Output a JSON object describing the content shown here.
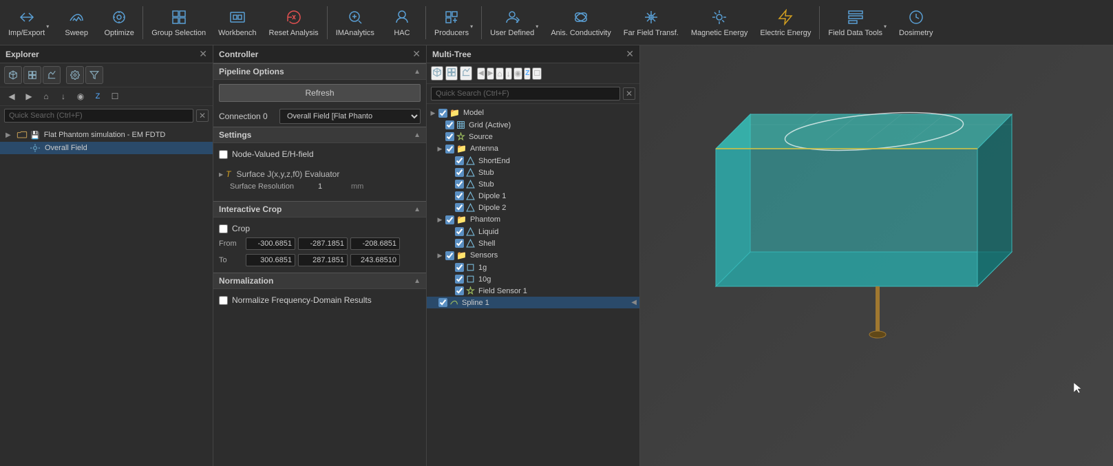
{
  "toolbar": {
    "items": [
      {
        "id": "imp-export",
        "label": "Imp/Export",
        "icon": "import-export-icon",
        "hasArrow": true
      },
      {
        "id": "sweep",
        "label": "Sweep",
        "icon": "sweep-icon",
        "hasArrow": false
      },
      {
        "id": "optimize",
        "label": "Optimize",
        "icon": "optimize-icon",
        "hasArrow": false
      },
      {
        "id": "group-selection",
        "label": "Group Selection",
        "icon": "group-selection-icon",
        "hasArrow": false
      },
      {
        "id": "workbench",
        "label": "Workbench",
        "icon": "workbench-icon",
        "hasArrow": false
      },
      {
        "id": "reset-analysis",
        "label": "Reset Analysis",
        "icon": "reset-analysis-icon",
        "hasArrow": false
      },
      {
        "id": "imanalytics",
        "label": "IMAnalytics",
        "icon": "imanalytics-icon",
        "hasArrow": false
      },
      {
        "id": "hac",
        "label": "HAC",
        "icon": "hac-icon",
        "hasArrow": false
      },
      {
        "id": "producers",
        "label": "Producers",
        "icon": "producers-icon",
        "hasArrow": true
      },
      {
        "id": "user-defined",
        "label": "User Defined",
        "icon": "user-defined-icon",
        "hasArrow": true
      },
      {
        "id": "anis-conductivity",
        "label": "Anis. Conductivity",
        "icon": "anis-icon",
        "hasArrow": false
      },
      {
        "id": "far-field-transf",
        "label": "Far Field Transf.",
        "icon": "far-field-icon",
        "hasArrow": false
      },
      {
        "id": "magnetic-energy",
        "label": "Magnetic Energy",
        "icon": "magnetic-energy-icon",
        "hasArrow": false
      },
      {
        "id": "electric-energy",
        "label": "Electric Energy",
        "icon": "electric-energy-icon",
        "hasArrow": false
      },
      {
        "id": "field-data-tools",
        "label": "Field Data Tools",
        "icon": "field-data-icon",
        "hasArrow": true
      },
      {
        "id": "dosimetry",
        "label": "Dosimetry",
        "icon": "dosimetry-icon",
        "hasArrow": false
      }
    ]
  },
  "explorer": {
    "title": "Explorer",
    "search_placeholder": "Quick Search (Ctrl+F)",
    "tree": [
      {
        "id": "sim-root",
        "label": "Flat Phantom simulation - EM FDTD",
        "indent": 0,
        "expanded": true,
        "hasExpand": true,
        "selected": false
      },
      {
        "id": "overall-field",
        "label": "Overall Field",
        "indent": 1,
        "expanded": false,
        "hasExpand": false,
        "selected": true
      }
    ]
  },
  "controller": {
    "title": "Controller",
    "pipeline_options_label": "Pipeline Options",
    "refresh_label": "Refresh",
    "connection_label": "Connection 0",
    "connection_value": "Overall Field [Flat Phanto",
    "settings_label": "Settings",
    "node_valued_label": "Node-Valued E/H-field",
    "node_valued_checked": false,
    "surface_j_label": "Surface J(x,y,z,f0) Evaluator",
    "surface_resolution_label": "Surface Resolution",
    "surface_resolution_value": "1",
    "surface_resolution_unit": "mm",
    "interactive_crop_label": "Interactive Crop",
    "crop_label": "Crop",
    "crop_checked": false,
    "from_label": "From",
    "from_x": "-300.6851",
    "from_y": "-287.1851",
    "from_z": "-208.6851",
    "to_label": "To",
    "to_x": "300.6851",
    "to_y": "287.1851",
    "to_z": "243.68510",
    "normalization_label": "Normalization",
    "normalize_label": "Normalize Frequency-Domain Results",
    "normalize_checked": false
  },
  "multitree": {
    "title": "Multi-Tree",
    "search_placeholder": "Quick Search (Ctrl+F)",
    "tree": [
      {
        "id": "model",
        "label": "Model",
        "indent": 0,
        "checked": true,
        "isFolder": true,
        "expanded": true
      },
      {
        "id": "grid-active",
        "label": "Grid (Active)",
        "indent": 1,
        "checked": true,
        "isFolder": false,
        "isGrid": true
      },
      {
        "id": "source",
        "label": "Source",
        "indent": 1,
        "checked": true,
        "isFolder": false,
        "isSource": true
      },
      {
        "id": "antenna",
        "label": "Antenna",
        "indent": 1,
        "checked": true,
        "isFolder": true,
        "expanded": true
      },
      {
        "id": "shortend",
        "label": "ShortEnd",
        "indent": 2,
        "checked": true,
        "isFolder": false
      },
      {
        "id": "stub1",
        "label": "Stub",
        "indent": 2,
        "checked": true,
        "isFolder": false
      },
      {
        "id": "stub2",
        "label": "Stub",
        "indent": 2,
        "checked": true,
        "isFolder": false
      },
      {
        "id": "dipole1",
        "label": "Dipole 1",
        "indent": 2,
        "checked": true,
        "isFolder": false
      },
      {
        "id": "dipole2",
        "label": "Dipole 2",
        "indent": 2,
        "checked": true,
        "isFolder": false
      },
      {
        "id": "phantom",
        "label": "Phantom",
        "indent": 1,
        "checked": true,
        "isFolder": true,
        "expanded": true
      },
      {
        "id": "liquid",
        "label": "Liquid",
        "indent": 2,
        "checked": true,
        "isFolder": false
      },
      {
        "id": "shell",
        "label": "Shell",
        "indent": 2,
        "checked": true,
        "isFolder": false
      },
      {
        "id": "sensors",
        "label": "Sensors",
        "indent": 1,
        "checked": true,
        "isFolder": true,
        "expanded": true
      },
      {
        "id": "1g",
        "label": "1g",
        "indent": 2,
        "checked": true,
        "isFolder": false
      },
      {
        "id": "10g",
        "label": "10g",
        "indent": 2,
        "checked": true,
        "isFolder": false
      },
      {
        "id": "field-sensor-1",
        "label": "Field Sensor 1",
        "indent": 2,
        "checked": true,
        "isFolder": false,
        "isSource": true
      },
      {
        "id": "spline1",
        "label": "Spline 1",
        "indent": 0,
        "checked": true,
        "isFolder": false,
        "isSource": true,
        "hasArrow": true
      }
    ]
  },
  "viewport": {
    "background_color": "#3d4a4a"
  },
  "colors": {
    "accent": "#5a8fc2",
    "teal_box": "#4fc8c8",
    "toolbar_bg": "#2d2d2d",
    "panel_bg": "#2d2d2d",
    "selected_bg": "#2a4a6a"
  }
}
